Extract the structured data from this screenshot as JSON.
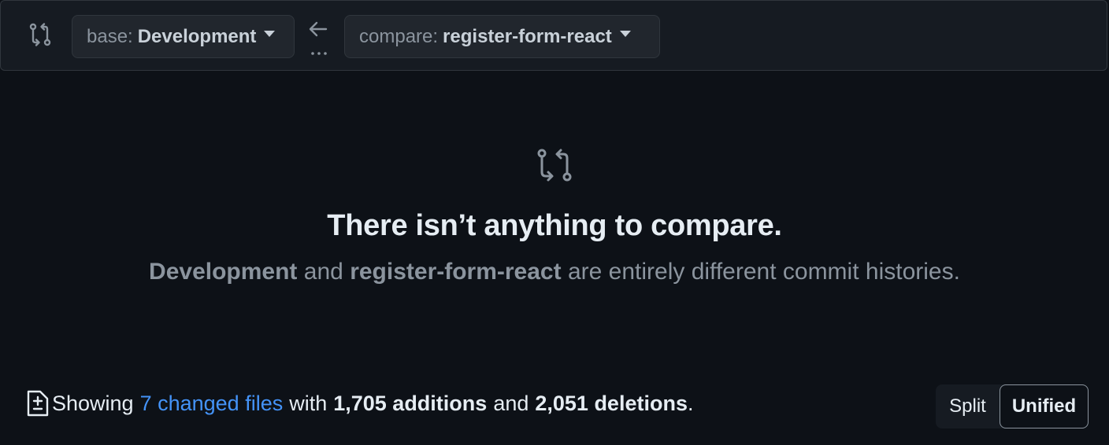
{
  "range": {
    "base_label": "base:",
    "base_value": "Development",
    "compare_label": "compare:",
    "compare_value": "register-form-react"
  },
  "blank": {
    "title": "There isn’t anything to compare.",
    "branch_a": "Development",
    "conj": "and",
    "branch_b": "register-form-react",
    "suffix": "are entirely different commit histories."
  },
  "toc": {
    "showing": "Showing",
    "files_link": "7 changed files",
    "with": "with",
    "additions": "1,705 additions",
    "and": "and",
    "deletions": "2,051 deletions",
    "period": "."
  },
  "view": {
    "split": "Split",
    "unified": "Unified",
    "selected": "Unified"
  },
  "colors": {
    "background": "#0d1117",
    "link": "#4493f8",
    "muted": "#8b949e"
  },
  "icons": [
    "git-compare-icon",
    "caret-down-icon",
    "arrow-left-icon",
    "ellipsis-icon",
    "file-diff-icon"
  ]
}
